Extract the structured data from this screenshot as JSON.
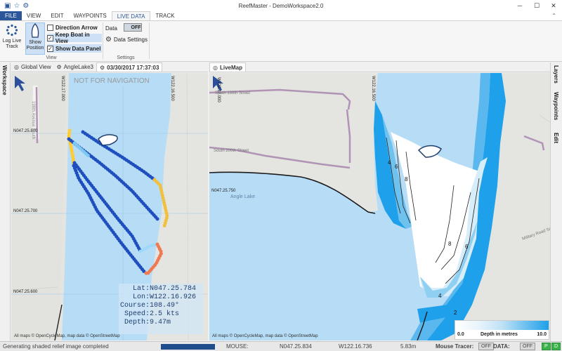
{
  "app": {
    "title": "ReefMaster - DemoWorkspace2.0",
    "window_buttons": {
      "minimize": "─",
      "maximize": "☐",
      "close": "✕"
    }
  },
  "menu": {
    "tabs": [
      {
        "label": "FILE"
      },
      {
        "label": "VIEW"
      },
      {
        "label": "EDIT"
      },
      {
        "label": "WAYPOINTS"
      },
      {
        "label": "LIVE DATA"
      },
      {
        "label": "TRACK"
      }
    ],
    "active_tab": "LIVE DATA"
  },
  "ribbon": {
    "log_live_track": "Log Live Track",
    "show_position": "Show Position",
    "direction_arrow": "Direction Arrow",
    "keep_boat_in_view": "Keep Boat in View",
    "show_data_panel": "Show Data Panel",
    "view_group_label": "View",
    "data_label": "Data",
    "data_toggle": "OFF",
    "data_settings": "Data Settings",
    "settings_group_label": "Settings",
    "checkboxes": {
      "direction_arrow": false,
      "keep_boat_in_view": true,
      "show_data_panel": true
    }
  },
  "left_sidebar": {
    "label": "Workspace"
  },
  "right_sidebar": {
    "items": [
      "Layers",
      "Waypoints",
      "Edit"
    ]
  },
  "left_pane": {
    "tabs": [
      "Global View",
      "AngleLake3",
      "03/30/2017 17:37:03"
    ],
    "active_tab_index": 2,
    "watermark": "NOT FOR NAVIGATION",
    "coords_top": [
      "W122.17.000",
      "W122.16.500"
    ],
    "coords_left": [
      "N047.25.800",
      "N047.25.700",
      "N047.25.600"
    ],
    "street_label": "198th Avenue South",
    "attribution": "All maps © OpenCycleMap, map data © OpenStreetMap",
    "data_panel": {
      "lat_label": "Lat:",
      "lat": "N047.25.784",
      "lon_label": "Lon:",
      "lon": "W122.16.926",
      "course_label": "Course:",
      "course": "108.49°",
      "speed_label": "Speed:",
      "speed": "2.5 kts",
      "depth_label": "Depth:",
      "depth": "9.47m"
    }
  },
  "right_pane": {
    "tabs": [
      "LiveMap"
    ],
    "coords_top": [
      "W122.17.000",
      "W122.16.500"
    ],
    "coord_left": "N047.25.750",
    "lake_label": "Angle Lake",
    "street_labels": [
      "South 198th Street",
      "South 200th Street",
      "Military Road South"
    ],
    "contour_labels": [
      "4",
      "6",
      "8",
      "8",
      "6",
      "4",
      "2"
    ],
    "attribution": "All maps © OpenCycleMap, map data © OpenStreetMap",
    "legend": {
      "min": "0.0",
      "title": "Depth in metres",
      "max": "10.0"
    }
  },
  "status_bar": {
    "message": "Generating shaded relief image completed",
    "mouse_label": "MOUSE:",
    "mouse_lat": "N047.25.834",
    "mouse_lon": "W122.16.736",
    "mouse_depth": "5.83m",
    "tracer_label": "Mouse Tracer:",
    "tracer_state": "OFF",
    "data_label": "DATA:",
    "data_state": "OFF",
    "p_label": "P",
    "d_label": "D",
    "progress": 1.0
  },
  "colors": {
    "accent": "#2b579a",
    "water": "#b6dcf6",
    "land": "#e4e5e0",
    "deep": "#1ea0ea",
    "status_green": "#3cb34a"
  }
}
